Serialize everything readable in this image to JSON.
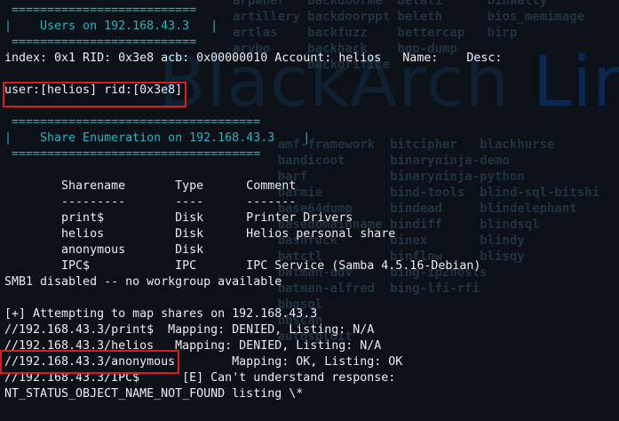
{
  "watermark": {
    "main": "BlackArch ",
    "accent": "Lin"
  },
  "background_tools": [
    "arpwner   backdoorme  belati      binwally",
    "artillery backdoorppt beleth      bios_memimage",
    "artlas    backfuzz    bettercap   birp",
    "arybo     backhack    bgp-dump",
    "          backorifice",
    "",
    "",
    "",
    "",
    "      amf-framework  bitcipher   blackhurse",
    "      bandicoot      binaryninja-demo",
    "      barf           binaryninja-python",
    "      barmie         bind-tools  blind-sql-bitshi",
    "      base64dump     bindead     blindelephant",
    "      basedomainname bindiff     blindsql",
    "      bashfuck       binex       blindy",
    "      batctl         binflow     blisqy",
    "      batman-adv     bing-ip2hosts",
    "      batman-alfred  bing-lfi-rfi",
    "      bbqsql",
    "      bbscan",
    "      autosploit"
  ],
  "terminal": {
    "lines": [
      {
        "text": " ==========================",
        "style": "cyan"
      },
      {
        "text": "|    Users on 192.168.43.3   |",
        "style": "cyan"
      },
      {
        "text": " ==========================",
        "style": "cyan"
      },
      {
        "text": "index: 0x1 RID: 0x3e8 acb: 0x00000010 Account: helios   Name:    Desc:",
        "style": "white"
      },
      {
        "text": "",
        "style": "white"
      },
      {
        "text": "user:[helios] rid:[0x3e8]",
        "style": "white"
      },
      {
        "text": "",
        "style": "white"
      },
      {
        "text": " ===================================",
        "style": "cyan"
      },
      {
        "text": "|    Share Enumeration on 192.168.43.3    |",
        "style": "cyan"
      },
      {
        "text": " ===================================",
        "style": "cyan"
      },
      {
        "text": "",
        "style": "white"
      },
      {
        "text": "        Sharename       Type      Comment",
        "style": "white"
      },
      {
        "text": "        ---------       ----      -------",
        "style": "white"
      },
      {
        "text": "        print$          Disk      Printer Drivers",
        "style": "white"
      },
      {
        "text": "        helios          Disk      Helios personal share",
        "style": "white"
      },
      {
        "text": "        anonymous       Disk",
        "style": "white"
      },
      {
        "text": "        IPC$            IPC       IPC Service (Samba 4.5.16-Debian)",
        "style": "white"
      },
      {
        "text": "SMB1 disabled -- no workgroup available",
        "style": "white"
      },
      {
        "text": "",
        "style": "white"
      },
      {
        "text": "[+] Attempting to map shares on 192.168.43.3",
        "style": "white"
      },
      {
        "text": "//192.168.43.3/print$  Mapping: DENIED, Listing: N/A",
        "style": "white"
      },
      {
        "text": "//192.168.43.3/helios   Mapping: DENIED, Listing: N/A",
        "style": "white"
      },
      {
        "text": "//192.168.43.3/anonymous        Mapping: OK, Listing: OK",
        "style": "white"
      },
      {
        "text": "//192.168.43.3/IPC$      [E] Can't understand response:",
        "style": "white"
      },
      {
        "text": "NT_STATUS_OBJECT_NAME_NOT_FOUND listing \\*",
        "style": "white"
      }
    ]
  },
  "highlights": [
    {
      "label": "user-rid-highlight"
    },
    {
      "label": "anonymous-share-highlight"
    }
  ],
  "colors": {
    "background": "#0b1117",
    "text": "#e9eef3",
    "border_text": "#26b5c4",
    "highlight_box": "#e01b1b",
    "watermark": "#0f2130",
    "watermark_accent": "#0c2750"
  }
}
